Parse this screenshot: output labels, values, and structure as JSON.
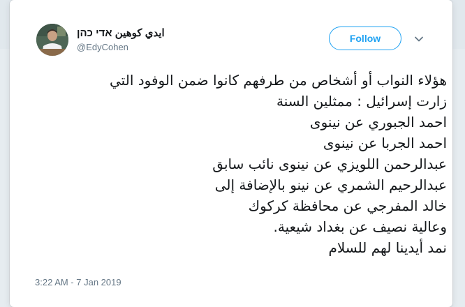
{
  "author": {
    "display_name": "ايدي كوهين אדי כהן",
    "handle": "@EdyCohen",
    "avatar_icon": "profile-photo"
  },
  "actions": {
    "follow_label": "Follow",
    "menu_icon": "chevron-down-icon"
  },
  "tweet": {
    "lines": [
      "هؤلاء النواب  أو أشخاص من طرفهم كانوا ضمن الوفود التي",
      "زارت إسرائيل : ممثلين السنة",
      "احمد الجبوري عن نينوى",
      "احمد الجربا عن نينوى",
      "عبدالرحمن اللويزي عن نينوى نائب سابق",
      "عبدالرحيم الشمري عن نينو بالإضافة إلى",
      "خالد المفرجي عن محافظة كركوك",
      "وعالية نصيف عن بغداد شيعية.",
      "نمد أيدينا لهم للسلام"
    ],
    "timestamp": "3:22 AM - 7 Jan 2019"
  },
  "colors": {
    "accent": "#1da1f2",
    "text": "#14171a",
    "secondary_text": "#657786"
  }
}
